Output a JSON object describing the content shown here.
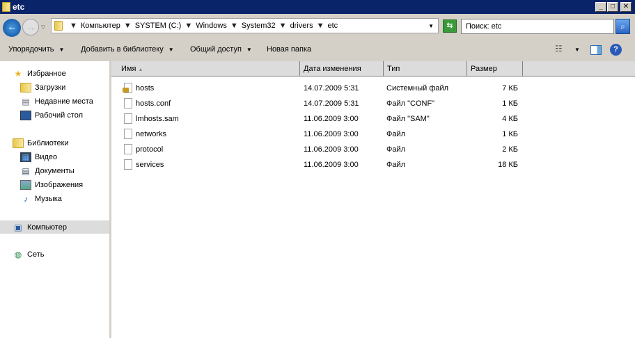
{
  "window": {
    "title": "etc"
  },
  "address": {
    "breadcrumb": [
      "Компьютер",
      "SYSTEM (C:)",
      "Windows",
      "System32",
      "drivers",
      "etc"
    ],
    "search_placeholder": "Поиск: etc"
  },
  "toolbar": {
    "organize": "Упорядочить",
    "add_library": "Добавить в библиотеку",
    "share": "Общий доступ",
    "new_folder": "Новая папка"
  },
  "sidebar": {
    "favorites": {
      "label": "Избранное",
      "items": [
        "Загрузки",
        "Недавние места",
        "Рабочий стол"
      ]
    },
    "libraries": {
      "label": "Библиотеки",
      "items": [
        "Видео",
        "Документы",
        "Изображения",
        "Музыка"
      ]
    },
    "computer": "Компьютер",
    "network": "Сеть"
  },
  "columns": {
    "name": "Имя",
    "date": "Дата изменения",
    "type": "Тип",
    "size": "Размер"
  },
  "files": [
    {
      "name": "hosts",
      "date": "14.07.2009 5:31",
      "type": "Системный файл",
      "size": "7 КБ"
    },
    {
      "name": "hosts.conf",
      "date": "14.07.2009 5:31",
      "type": "Файл \"CONF\"",
      "size": "1 КБ"
    },
    {
      "name": "lmhosts.sam",
      "date": "11.06.2009 3:00",
      "type": "Файл \"SAM\"",
      "size": "4 КБ"
    },
    {
      "name": "networks",
      "date": "11.06.2009 3:00",
      "type": "Файл",
      "size": "1 КБ"
    },
    {
      "name": "protocol",
      "date": "11.06.2009 3:00",
      "type": "Файл",
      "size": "2 КБ"
    },
    {
      "name": "services",
      "date": "11.06.2009 3:00",
      "type": "Файл",
      "size": "18 КБ"
    }
  ]
}
